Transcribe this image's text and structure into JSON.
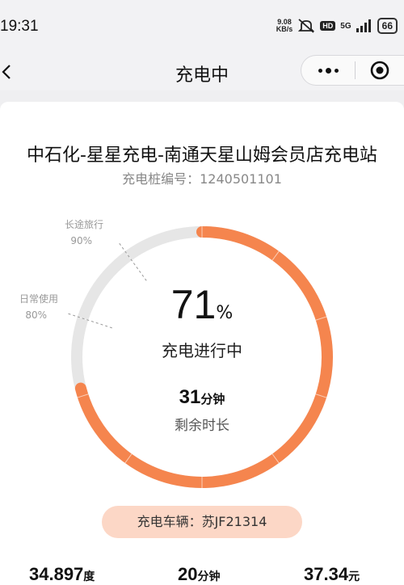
{
  "status_bar": {
    "time": "19:31",
    "net_speed_value": "9.08",
    "net_speed_unit": "KB/s",
    "hd": "HD",
    "signal": "5G",
    "battery": "66"
  },
  "nav": {
    "title": "充电中"
  },
  "station": {
    "name": "中石化-星星充电-南通天星山姆会员店充电站",
    "pile_no": "充电桩编号：1240501101"
  },
  "gauge": {
    "percent_value": 71,
    "percent": "71",
    "percent_sign": "%",
    "status": "充电进行中",
    "remaining_num": "31",
    "remaining_unit": "分钟",
    "remaining_label": "剩余时长",
    "marks": [
      {
        "label": "长途旅行",
        "value": "90%"
      },
      {
        "label": "日常使用",
        "value": "80%"
      }
    ],
    "colors": {
      "progress": "#f5854e",
      "track": "#e6e6e6"
    }
  },
  "vehicle": {
    "text": "充电车辆：苏JF21314"
  },
  "stats": [
    {
      "value": "34.897",
      "unit": "度"
    },
    {
      "value": "20",
      "unit": "分钟"
    },
    {
      "value": "37.34",
      "unit": "元"
    }
  ]
}
